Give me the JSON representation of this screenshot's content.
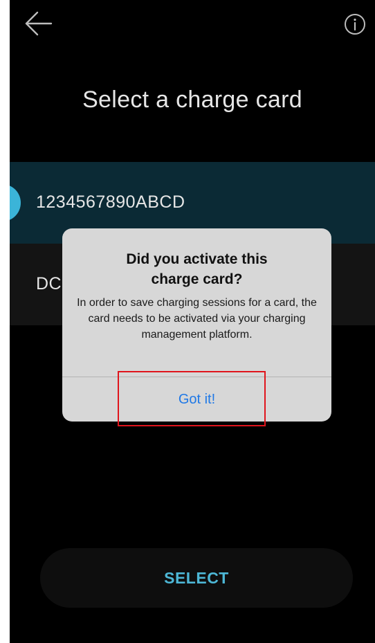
{
  "header": {
    "back_icon": "arrow-left-icon",
    "info_icon": "info-circle-icon",
    "title": "Select a charge card"
  },
  "cards": [
    {
      "label": "1234567890ABCD",
      "selected": true
    },
    {
      "label": "DC",
      "selected": false
    }
  ],
  "footer": {
    "select_label": "SELECT"
  },
  "dialog": {
    "title": "Did you activate this\ncharge card?",
    "message": "In order to save charging sessions for a card, the card needs to be activated via your charging management platform.",
    "button_label": "Got it!"
  },
  "colors": {
    "background": "#000000",
    "accent": "#3bb4d8",
    "selected_row": "#0b2a35",
    "dialog_button": "#1f78e6",
    "highlight": "#e0141b"
  }
}
